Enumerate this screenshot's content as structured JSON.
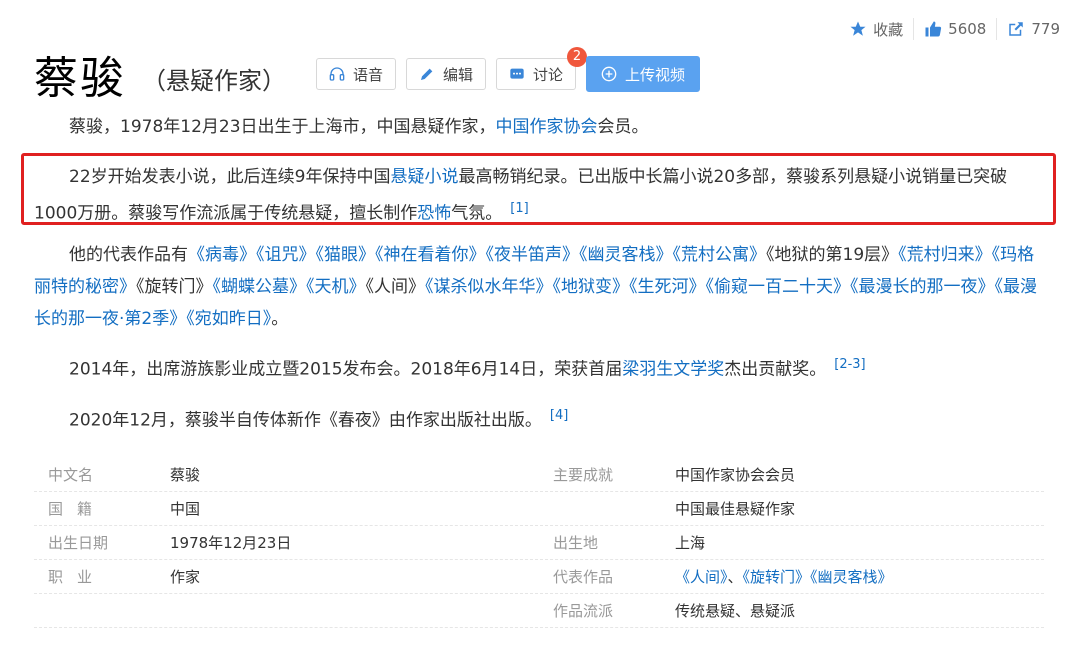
{
  "actions": {
    "favorite_label": "收藏",
    "like_count": "5608",
    "share_count": "779"
  },
  "header": {
    "title": "蔡骏",
    "subtitle": "（悬疑作家）",
    "btn_voice": "语音",
    "btn_edit": "编辑",
    "btn_discuss": "讨论",
    "discuss_badge": "2",
    "btn_upload": "上传视频"
  },
  "paragraphs": {
    "p1_a": "蔡骏，1978年12月23日出生于上海市，中国悬疑作家，",
    "p1_link": "中国作家协会",
    "p1_b": "会员。",
    "p2_a": "22岁开始发表小说，此后连续9年保持中国",
    "p2_link1": "悬疑小说",
    "p2_b": "最高畅销纪录。已出版中长篇小说20多部，蔡骏系列悬疑小说销量已突破1000万册。蔡骏写作流派属于传统悬疑，擅长制作",
    "p2_link2": "恐怖",
    "p2_c": "气氛。",
    "p2_ref": "[1]",
    "p3_a": "他的代表作品有",
    "p3_works": "《病毒》《诅咒》《猫眼》《神在看着你》《夜半笛声》《幽灵客栈》《荒村公寓》",
    "p3_b": "《地狱的第19层》",
    "p3_works2": "《荒村归来》《玛格丽特的秘密》",
    "p3_c": "《旋转门》",
    "p3_works3": "《蝴蝶公墓》《天机》",
    "p3_d": "《人间》",
    "p3_works4": "《谋杀似水年华》《地狱变》《生死河》《偷窥一百二十天》《最漫长的那一夜》《最漫长的那一夜·第2季》《宛如昨日》",
    "p3_e": "。",
    "p4_a": "2014年，出席游族影业成立暨2015发布会。2018年6月14日，荣获首届",
    "p4_link": "梁羽生文学奖",
    "p4_b": "杰出贡献奖。",
    "p4_ref": "[2-3]",
    "p5_a": "2020年12月，蔡骏半自传体新作《春夜》由作家出版社出版。",
    "p5_ref": "[4]"
  },
  "info": {
    "r1": {
      "k1": "中文名",
      "v1": "蔡骏",
      "k2": "主要成就",
      "v2": "中国作家协会会员"
    },
    "r2": {
      "k1": "国籍",
      "v1": "中国",
      "k2": "",
      "v2": "中国最佳悬疑作家"
    },
    "r3": {
      "k1": "出生日期",
      "v1": "1978年12月23日",
      "k2": "出生地",
      "v2": "上海"
    },
    "r4": {
      "k1": "职业",
      "v1": "作家",
      "k2": "代表作品",
      "v2a": "《人间》",
      "v2b": "、",
      "v2c": "《旋转门》",
      "v2d": "《幽灵客栈》"
    },
    "r5": {
      "k1": "",
      "v1": "",
      "k2": "作品流派",
      "v2": "传统悬疑、悬疑派"
    }
  },
  "colors": {
    "link": "#136ec2",
    "highlight_border": "#e02020",
    "primary_button": "#5aa2f0",
    "badge": "#f0573c"
  }
}
